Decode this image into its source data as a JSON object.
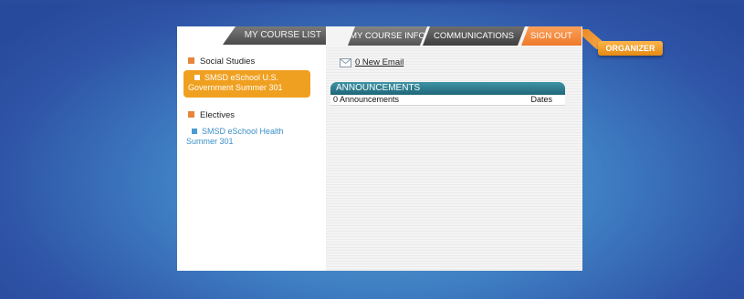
{
  "nav": {
    "my_course_list": "MY COURSE LIST",
    "my_course_info": "MY COURSE INFO",
    "communications": "COMMUNICATIONS",
    "sign_out": "SIGN OUT",
    "organizer": "ORGANIZER"
  },
  "sidebar": {
    "categories": [
      {
        "label": "Social Studies",
        "course_line1": "SMSD eSchool U.S.",
        "course_line2": "Government Summer 301"
      },
      {
        "label": "Electives",
        "course_line1": "SMSD eSchool Health",
        "course_line2": "Summer 301"
      }
    ]
  },
  "main": {
    "email_link": "0 New Email",
    "announcements": {
      "header": "ANNOUNCEMENTS",
      "count_text": "0 Announcements",
      "dates_label": "Dates"
    }
  },
  "colors": {
    "accent_orange": "#f0a020",
    "signout_orange": "#ee7a2a",
    "teal_header": "#2a7d8f",
    "link_blue": "#3a8fc8"
  },
  "icons": {
    "email": "envelope-icon",
    "category_bullet": "square-bullet-icon"
  }
}
